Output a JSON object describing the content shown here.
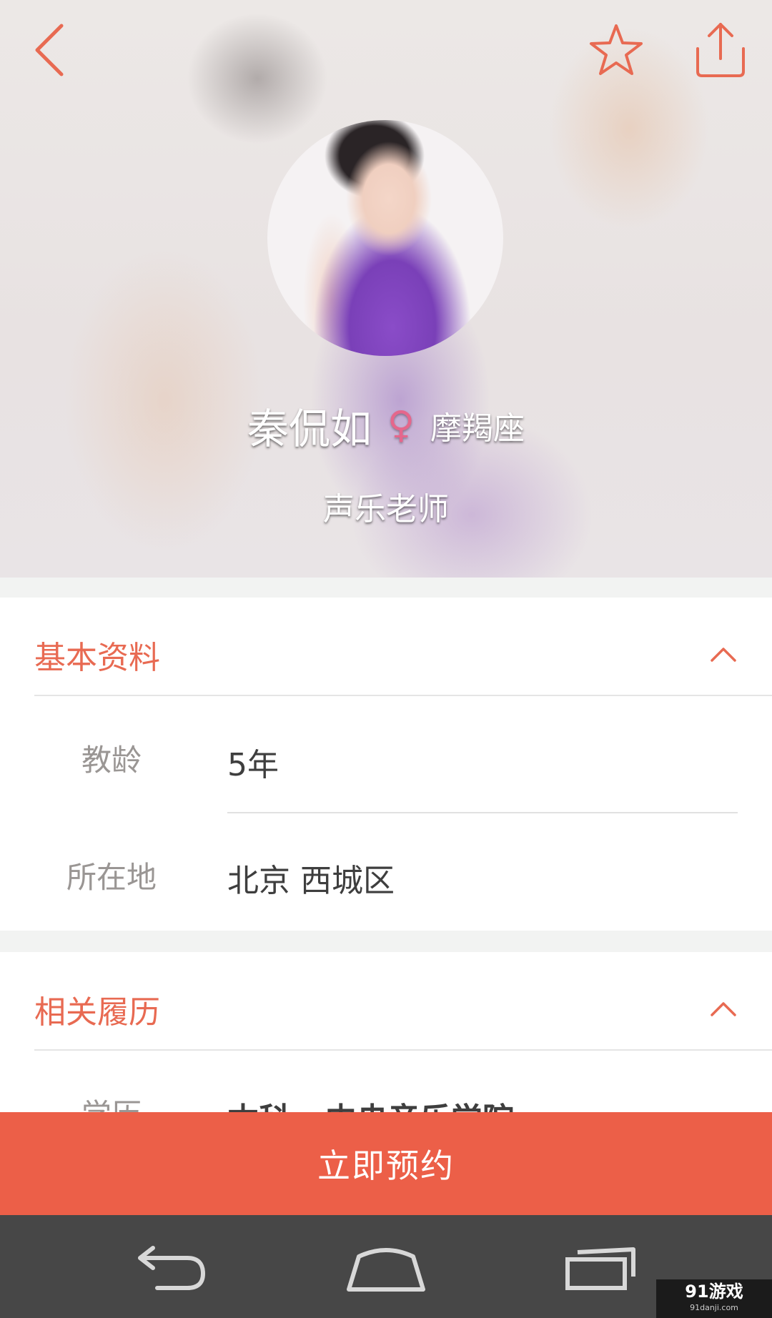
{
  "profile": {
    "name": "秦侃如",
    "gender_icon": "♀",
    "zodiac": "摩羯座",
    "title": "声乐老师"
  },
  "header": {
    "back_icon": "chevron-left-icon",
    "favorite_icon": "star-icon",
    "share_icon": "share-icon",
    "icon_color": "#e86a52"
  },
  "basic_info": {
    "title": "基本资料",
    "rows": [
      {
        "label": "教龄",
        "value": "5年"
      },
      {
        "label": "所在地",
        "value": "北京 西城区"
      }
    ]
  },
  "history": {
    "title": "相关履历",
    "rows": [
      {
        "label": "学历",
        "value": "本科 - 中央音乐学院"
      }
    ]
  },
  "cta": {
    "label": "立即预约",
    "color": "#ec5f48"
  },
  "watermark": {
    "text": "91游戏",
    "sub": "91danji.com"
  }
}
